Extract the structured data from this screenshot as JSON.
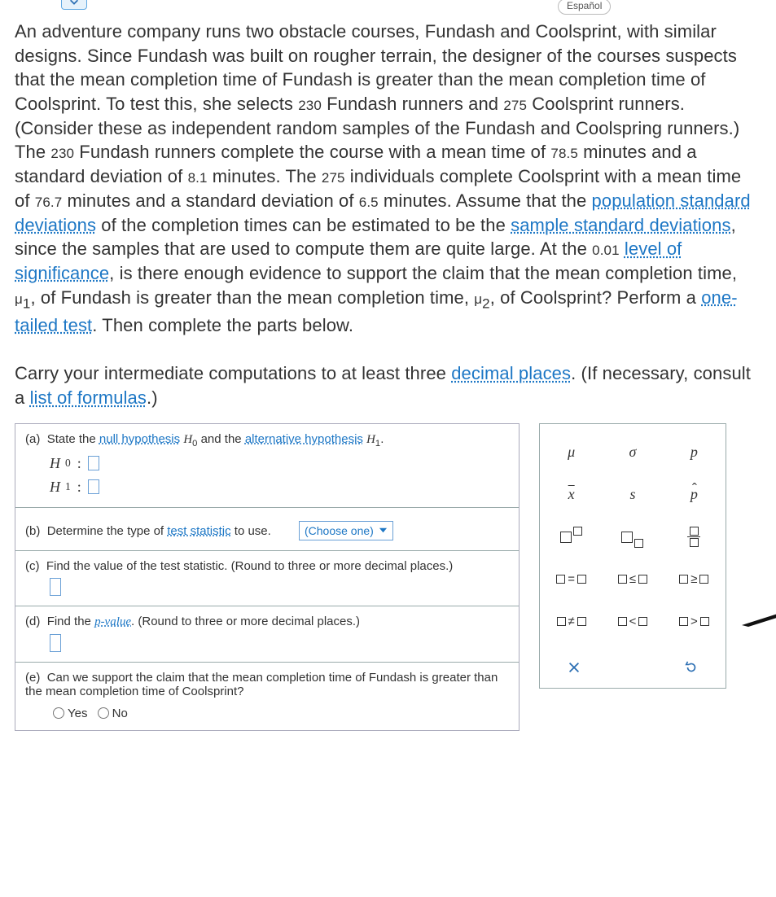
{
  "header": {
    "language": "Español"
  },
  "problem": {
    "p1_a": "An adventure company runs two obstacle courses, Fundash and Coolsprint, with similar designs. Since Fundash was built on rougher terrain, the designer of the courses suspects that the mean completion time of Fundash is greater than the mean completion time of Coolsprint. To test this, she selects ",
    "n1": "230",
    "p1_b": " Fundash runners and ",
    "n2": "275",
    "p1_c": " Coolsprint runners. (Consider these as independent random samples of the Fundash and Coolspring runners.) The ",
    "n1b": "230",
    "p1_d": " Fundash runners complete the course with a mean time of ",
    "m1": "78.5",
    "p1_e": " minutes and a standard deviation of ",
    "s1": "8.1",
    "p1_f": " minutes. The ",
    "n2b": "275",
    "p1_g": " individuals complete Coolsprint with a mean time of ",
    "m2": "76.7",
    "p1_h": " minutes and a standard deviation of ",
    "s2": "6.5",
    "p1_i": " minutes. Assume that the ",
    "link1": "population standard deviations",
    "p1_j": " of the completion times can be estimated to be the ",
    "link2": "sample standard deviations",
    "p1_k": ", since the samples that are used to compute them are quite large. At the ",
    "alpha": "0.01",
    "p1_l": " ",
    "link3": "level of significance",
    "p1_m": ", is there enough evidence to support the claim that the mean completion time, ",
    "mu1": "μ",
    "mu1s": "1",
    "p1_n": ", of Fundash is greater than the mean completion time, ",
    "mu2": "μ",
    "mu2s": "2",
    "p1_o": ", of Coolsprint? Perform a ",
    "link4": "one-tailed test",
    "p1_p": ". Then complete the parts below.",
    "p2_a": "Carry your intermediate computations to at least three ",
    "link5": "decimal places",
    "p2_b": ". (If necessary, consult a ",
    "link6": "list of formulas",
    "p2_c": ".)"
  },
  "parts": {
    "a": {
      "label": "(a)",
      "text_a": "State the ",
      "link_nh": "null hypothesis",
      "text_b": " ",
      "h0": "H",
      "h0s": "0",
      "text_c": " and the ",
      "link_ah": "alternative hypothesis",
      "text_d": " ",
      "h1": "H",
      "h1s": "1",
      "text_e": ".",
      "row1_sym": "H",
      "row1_sub": "0",
      "row2_sym": "H",
      "row2_sub": "1",
      "colon": ":"
    },
    "b": {
      "label": "(b)",
      "text_a": "Determine the type of ",
      "link": "test statistic",
      "text_b": " to use.",
      "select": "(Choose one)"
    },
    "c": {
      "label": "(c)",
      "text": "Find the value of the test statistic. (Round to three or more decimal places.)"
    },
    "d": {
      "label": "(d)",
      "text_a": "Find the ",
      "link": "p-value",
      "text_b": ". (Round to three or more decimal places.)"
    },
    "e": {
      "label": "(e)",
      "text": "Can we support the claim that the mean completion time of Fundash is greater than the mean completion time of Coolsprint?",
      "yes": "Yes",
      "no": "No"
    }
  },
  "palette": {
    "mu": "μ",
    "sigma": "σ",
    "p": "p",
    "xbar": "x",
    "s": "s",
    "phat": "p",
    "eq": "=",
    "le": "≤",
    "ge": "≥",
    "ne": "≠",
    "lt": "<",
    "gt": ">"
  }
}
